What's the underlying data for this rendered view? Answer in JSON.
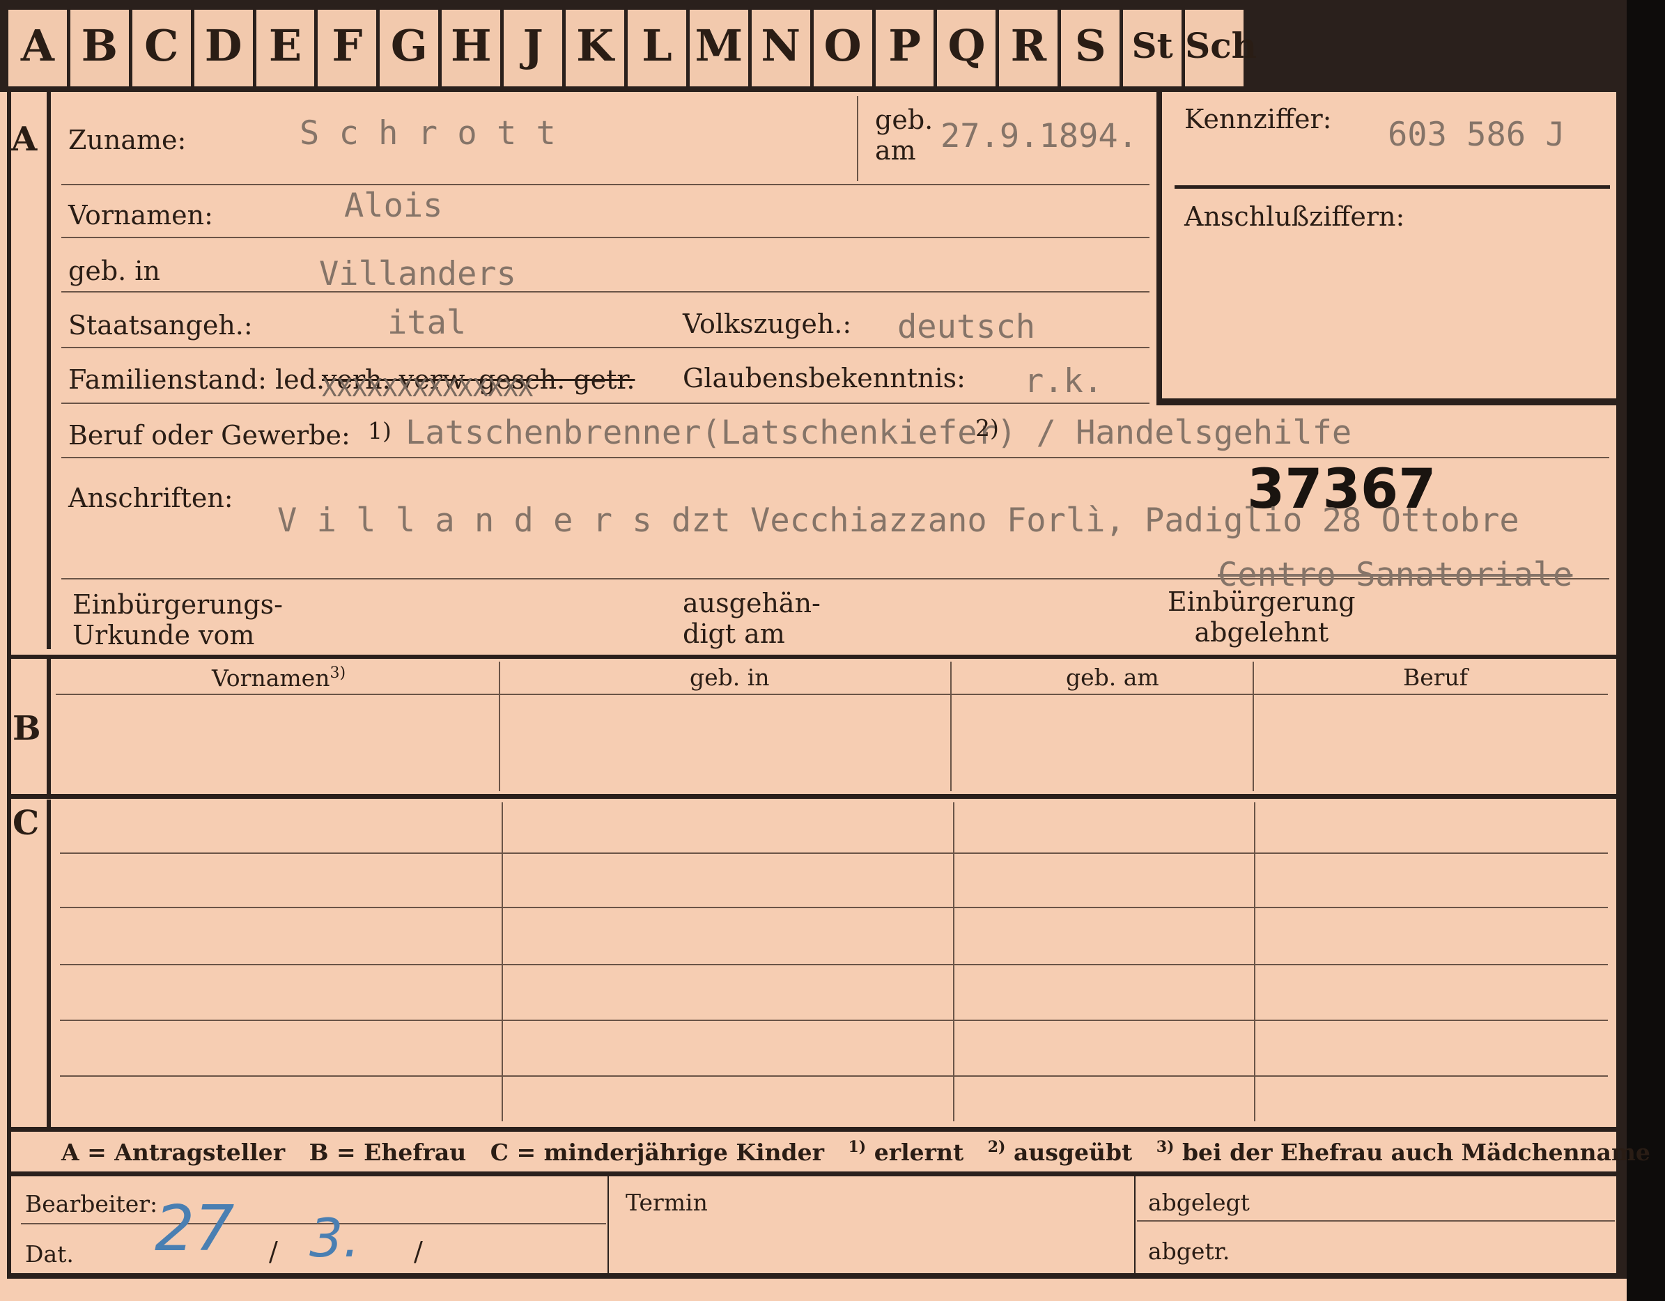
{
  "tabs": [
    "A",
    "B",
    "C",
    "D",
    "E",
    "F",
    "G",
    "H",
    "J",
    "K",
    "L",
    "M",
    "N",
    "O",
    "P",
    "Q",
    "R",
    "S",
    "St",
    "Sch"
  ],
  "sections": {
    "a": "A",
    "b": "B",
    "c": "C"
  },
  "person": {
    "zuname_label": "Zuname:",
    "zuname": "S c h r o t t",
    "geb_am_label": "geb.\nam",
    "geb_am": "27.9.1894.",
    "vornamen_label": "Vornamen:",
    "vornamen": "Alois",
    "geb_in_label": "geb. in",
    "geb_in": "Villanders",
    "staatsangeh_label": "Staatsangeh.:",
    "staatsangeh": "ital",
    "volkszugeh_label": "Volkszugeh.:",
    "volkszugeh": "deutsch",
    "familienstand_label": "Familienstand: led.",
    "familienstand_struck": "verh. verw. gesch. getr.",
    "familienstand_x": "XXXXXXXXXXXXXX",
    "glaubens_label": "Glaubensbekenntnis:",
    "glaubens": "r.k.",
    "beruf_label": "Beruf oder Gewerbe:",
    "beruf_sup": "1)",
    "beruf": "Latschenbrenner(Latschenkiefer) / Handelsgehilfe",
    "beruf_mark": "2)",
    "anschriften_label": "Anschriften:",
    "stamp_number": "37367",
    "anschrift_1": "V i l l a n d e r s   dzt Vecchiazzano Forlì, Padiglio 28 Ottobre",
    "anschrift_2": "Centro Sanatoriale",
    "einbuergerung_urkunde_label": "Einbürgerungs-\nUrkunde vom",
    "ausgehaendigt_label": "ausgehän-\ndigt am",
    "einbuergerung_abgelehnt_label": "Einbürgerung\nabgelehnt"
  },
  "kennziffer": {
    "label": "Kennziffer:",
    "value": "603 586    J",
    "anschluss_label": "Anschlußziffern:"
  },
  "family_table": {
    "headers": [
      "Vornamen",
      "geb. in",
      "geb. am",
      "Beruf"
    ],
    "vornamen_sup": "3)"
  },
  "legend": {
    "a": "A = Antragsteller",
    "b": "B = Ehefrau",
    "c": "C = minderjährige Kinder",
    "n1_sup": "1)",
    "n1": "erlernt",
    "n2_sup": "2)",
    "n2": "ausgeübt",
    "n3_sup": "3)",
    "n3": "bei der Ehefrau auch Mädchenname"
  },
  "footer": {
    "bearbeiter_label": "Bearbeiter:",
    "dat_label": "Dat.",
    "dat_day": "27",
    "dat_sep1": "/",
    "dat_month": "3.",
    "dat_sep2": "/",
    "termin_label": "Termin",
    "abgelegt_label": "abgelegt",
    "abgetr_label": "abgetr."
  }
}
